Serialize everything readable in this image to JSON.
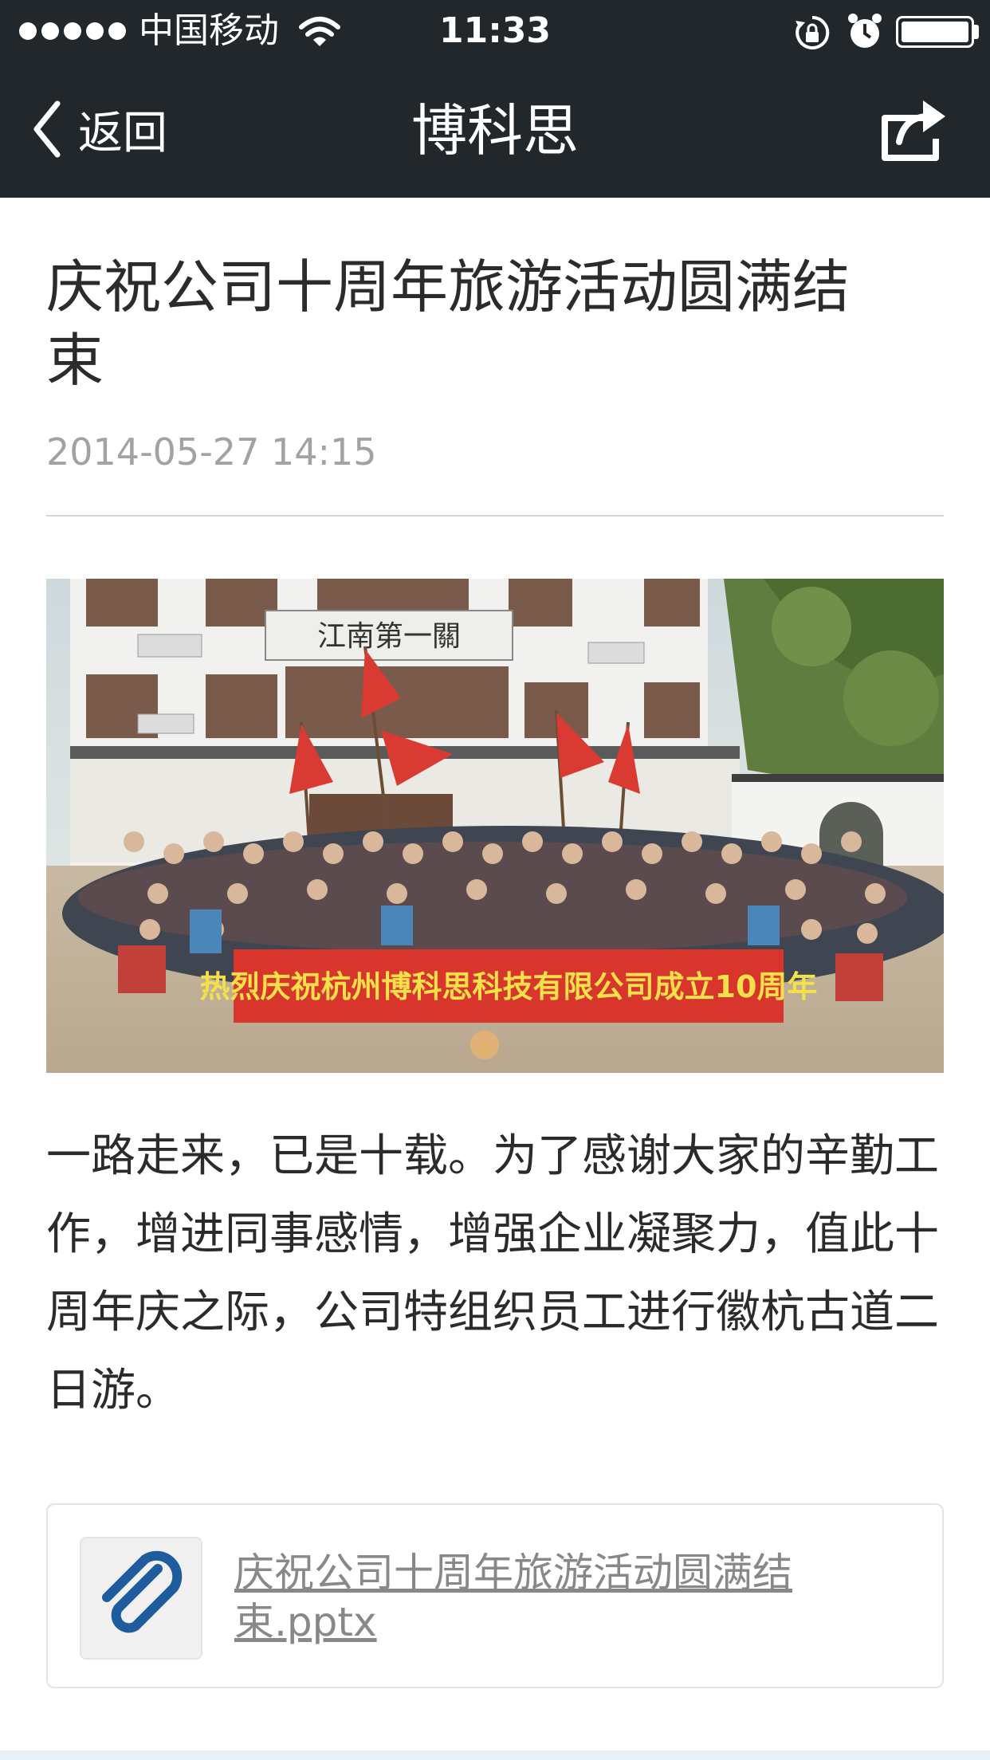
{
  "status_bar": {
    "carrier": "中国移动",
    "time": "11:33",
    "signal_bars": 5,
    "battery_level": 1.0,
    "icons": [
      "wifi-icon",
      "rotation-lock-icon",
      "alarm-icon",
      "battery-icon"
    ]
  },
  "nav": {
    "back_label": "返回",
    "title": "博科思",
    "share_icon": "share-icon"
  },
  "article": {
    "title": "庆祝公司十周年旅游活动圆满结束",
    "date": "2014-05-27 14:15",
    "photo": {
      "sign_text": "江南第一關",
      "banner_text": "热烈庆祝杭州博科思科技有限公司成立10周年"
    },
    "body": "一路走来，已是十载。为了感谢大家的辛勤工作，增进同事感情，增强企业凝聚力，值此十周年庆之际，公司特组织员工进行徽杭古道二日游。",
    "attachment": {
      "icon": "paperclip-icon",
      "filename": "庆祝公司十周年旅游活动圆满结束.pptx"
    }
  },
  "colors": {
    "header_bg": "#22272b",
    "link_gray": "#888888",
    "date_gray": "#a2a2a2",
    "paperclip_blue": "#1f5c9e",
    "banner_red": "#d8352c"
  }
}
